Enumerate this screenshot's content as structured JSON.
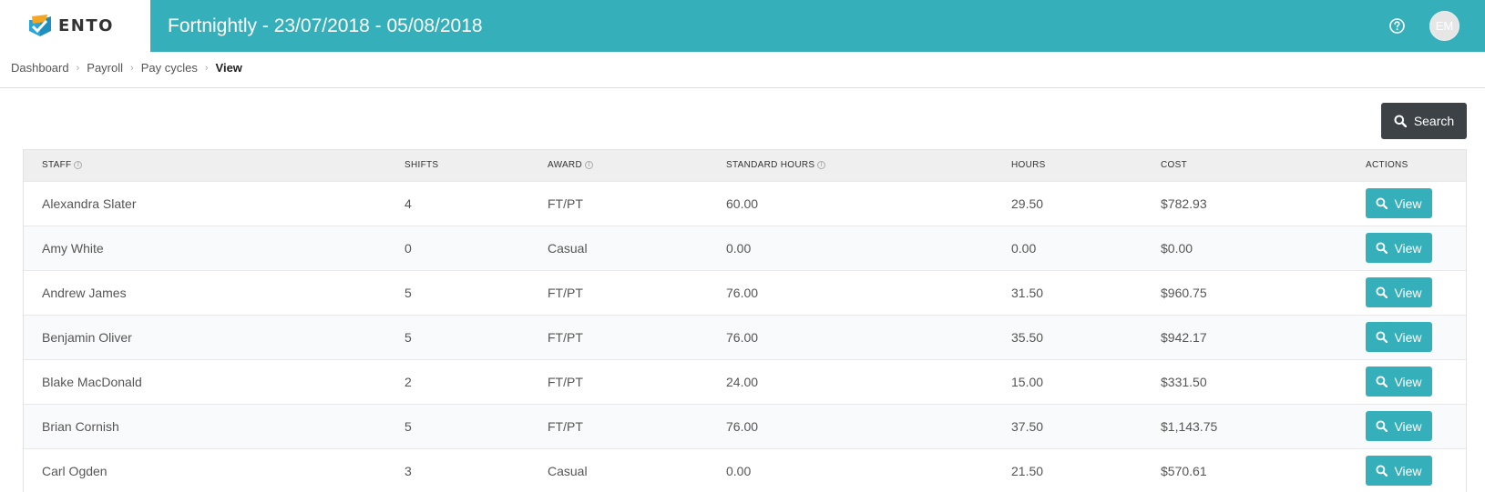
{
  "brand": {
    "name": "ENTO",
    "accent": "#35b0bb",
    "logo_orange": "#f5a623",
    "logo_blue": "#2aa5d6"
  },
  "header": {
    "title": "Fortnightly - 23/07/2018 - 05/08/2018",
    "help_icon": "help-circle-icon",
    "avatar_initials": "EM"
  },
  "breadcrumb": [
    {
      "label": "Dashboard"
    },
    {
      "label": "Payroll"
    },
    {
      "label": "Pay cycles"
    },
    {
      "label": "View",
      "current": true
    }
  ],
  "toolbar": {
    "search_label": "Search",
    "search_icon": "search-icon"
  },
  "table": {
    "columns": {
      "staff": "STAFF",
      "shifts": "SHIFTS",
      "award": "AWARD",
      "standard_hours": "STANDARD HOURS",
      "hours": "HOURS",
      "cost": "COST",
      "actions": "ACTIONS"
    },
    "info_glyph": "i",
    "view_label": "View",
    "rows": [
      {
        "staff": "Alexandra Slater",
        "shifts": "4",
        "award": "FT/PT",
        "standard_hours": "60.00",
        "hours": "29.50",
        "cost": "$782.93"
      },
      {
        "staff": "Amy White",
        "shifts": "0",
        "award": "Casual",
        "standard_hours": "0.00",
        "hours": "0.00",
        "cost": "$0.00"
      },
      {
        "staff": "Andrew James",
        "shifts": "5",
        "award": "FT/PT",
        "standard_hours": "76.00",
        "hours": "31.50",
        "cost": "$960.75"
      },
      {
        "staff": "Benjamin Oliver",
        "shifts": "5",
        "award": "FT/PT",
        "standard_hours": "76.00",
        "hours": "35.50",
        "cost": "$942.17"
      },
      {
        "staff": "Blake MacDonald",
        "shifts": "2",
        "award": "FT/PT",
        "standard_hours": "24.00",
        "hours": "15.00",
        "cost": "$331.50"
      },
      {
        "staff": "Brian Cornish",
        "shifts": "5",
        "award": "FT/PT",
        "standard_hours": "76.00",
        "hours": "37.50",
        "cost": "$1,143.75"
      },
      {
        "staff": "Carl Ogden",
        "shifts": "3",
        "award": "Casual",
        "standard_hours": "0.00",
        "hours": "21.50",
        "cost": "$570.61"
      }
    ]
  }
}
